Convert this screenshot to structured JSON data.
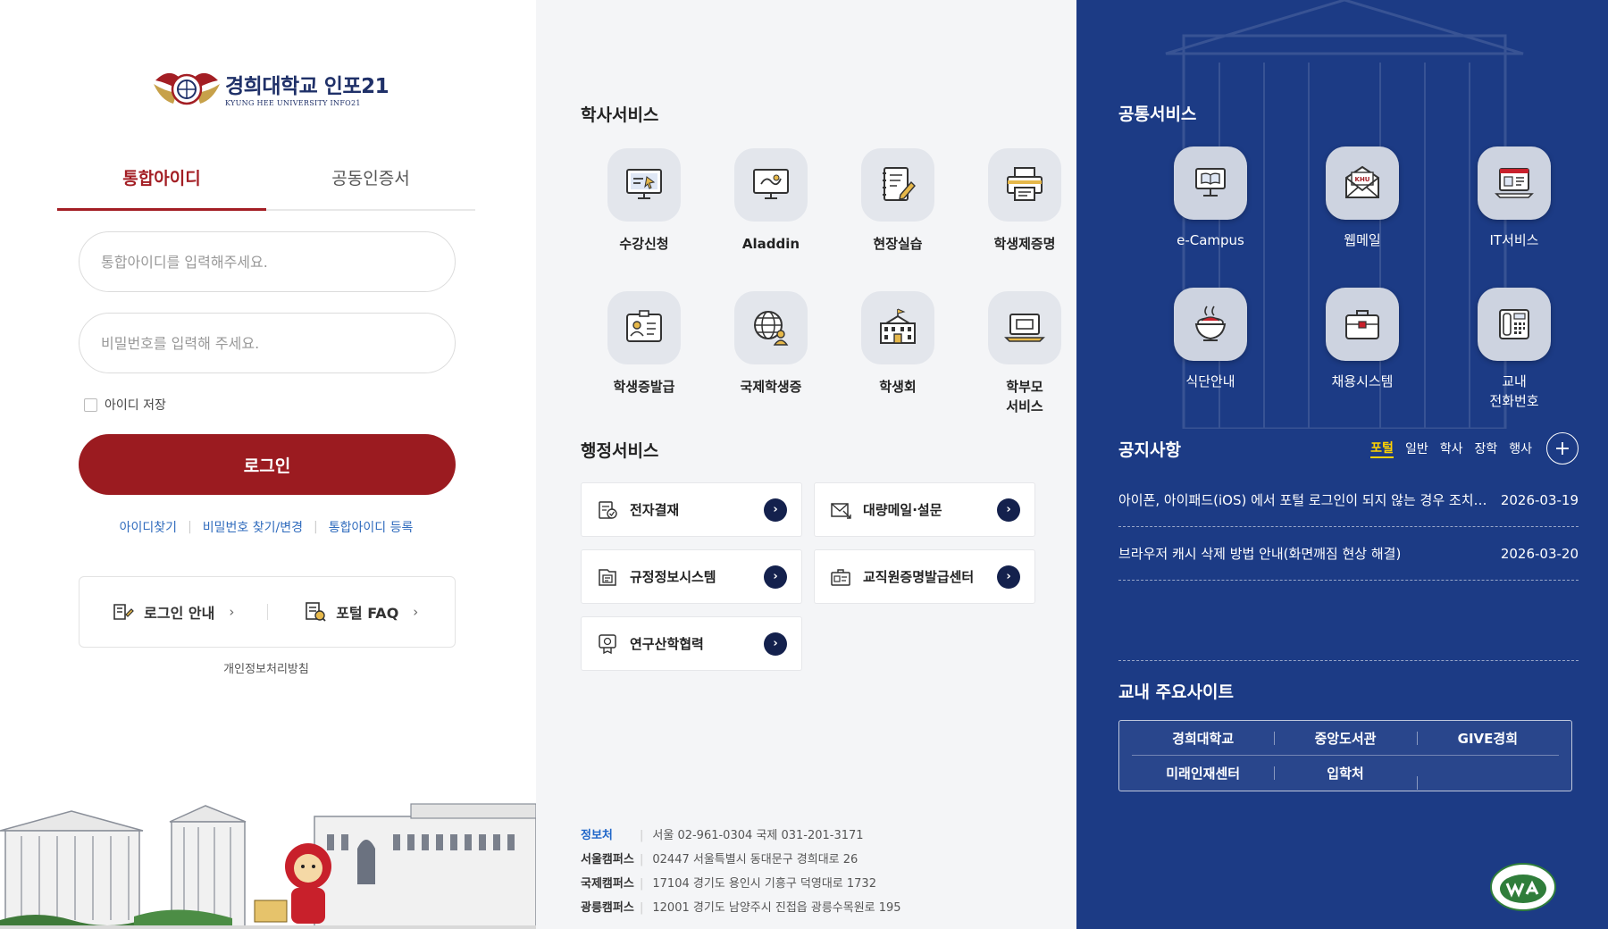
{
  "login": {
    "logo_title": "경희대학교 인포21",
    "logo_subtitle": "KYUNG HEE UNIVERSITY INFO21",
    "tabs": [
      {
        "label": "통합아이디",
        "active": true
      },
      {
        "label": "공동인증서",
        "active": false
      }
    ],
    "id_placeholder": "통합아이디를 입력해주세요.",
    "pw_placeholder": "비밀번호를 입력해 주세요.",
    "remember_label": "아이디 저장",
    "login_button": "로그인",
    "links": [
      "아이디찾기",
      "비밀번호 찾기/변경",
      "통합아이디 등록"
    ],
    "help": [
      {
        "label": "로그인 안내",
        "icon": "login-guide-icon"
      },
      {
        "label": "포털 FAQ",
        "icon": "faq-icon"
      }
    ],
    "privacy": "개인정보처리방침",
    "accent": "#9b1b20"
  },
  "academic": {
    "title": "학사서비스",
    "items": [
      {
        "label": "수강신청",
        "icon": "course-registration-icon"
      },
      {
        "label": "Aladdin",
        "icon": "aladdin-monitor-icon"
      },
      {
        "label": "현장실습",
        "icon": "field-practice-icon"
      },
      {
        "label": "학생제증명",
        "icon": "printer-icon"
      },
      {
        "label": "학생증발급",
        "icon": "id-card-icon"
      },
      {
        "label": "국제학생증",
        "icon": "globe-user-icon"
      },
      {
        "label": "학생회",
        "icon": "building-icon"
      },
      {
        "label": "학부모\n서비스",
        "icon": "laptop-icon"
      }
    ]
  },
  "admin": {
    "title": "행정서비스",
    "items": [
      {
        "label": "전자결재",
        "icon": "approval-icon"
      },
      {
        "label": "대량메일·설문",
        "icon": "mail-survey-icon"
      },
      {
        "label": "규정정보시스템",
        "icon": "regulation-icon"
      },
      {
        "label": "교직원증명발급센터",
        "icon": "staff-certificate-icon"
      },
      {
        "label": "연구산학협력",
        "icon": "research-icon"
      }
    ]
  },
  "footer": {
    "rows": [
      {
        "key": "정보처",
        "value": "서울 02-961-0304 국제 031-201-3171"
      },
      {
        "key": "서울캠퍼스",
        "value": "02447 서울특별시 동대문구 경희대로 26"
      },
      {
        "key": "국제캠퍼스",
        "value": "17104 경기도 용인시 기흥구 덕영대로 1732"
      },
      {
        "key": "광릉캠퍼스",
        "value": "12001 경기도 남양주시 진접읍 광릉수목원로 195"
      }
    ]
  },
  "common": {
    "title": "공통서비스",
    "items": [
      {
        "label": "e-Campus",
        "icon": "ecampus-book-icon"
      },
      {
        "label": "웹메일",
        "icon": "webmail-icon"
      },
      {
        "label": "IT서비스",
        "icon": "it-service-icon"
      },
      {
        "label": "식단안내",
        "icon": "meal-bowl-icon"
      },
      {
        "label": "채용시스템",
        "icon": "briefcase-icon"
      },
      {
        "label": "교내\n전화번호",
        "icon": "phone-icon"
      }
    ]
  },
  "notice": {
    "title": "공지사항",
    "tabs": [
      {
        "label": "포털",
        "active": true
      },
      {
        "label": "일반",
        "active": false
      },
      {
        "label": "학사",
        "active": false
      },
      {
        "label": "장학",
        "active": false
      },
      {
        "label": "행사",
        "active": false
      }
    ],
    "more": "+",
    "items": [
      {
        "title": "아이폰, 아이패드(iOS) 에서 포털 로그인이 되지 않는 경우 조치 방법",
        "date": "2026-03-19"
      },
      {
        "title": "브라우저 캐시 삭제 방법 안내(화면깨짐 현상 해결)",
        "date": "2026-03-20"
      }
    ]
  },
  "sites": {
    "title": "교내 주요사이트",
    "rows": [
      [
        "경희대학교",
        "중앙도서관",
        "GIVE경희"
      ],
      [
        "미래인재센터",
        "입학처",
        ""
      ]
    ]
  },
  "colors": {
    "navy": "#1c3b85",
    "dark_navy": "#14214d",
    "notice_active": "#ffd200",
    "link_blue": "#2f6bbd"
  }
}
